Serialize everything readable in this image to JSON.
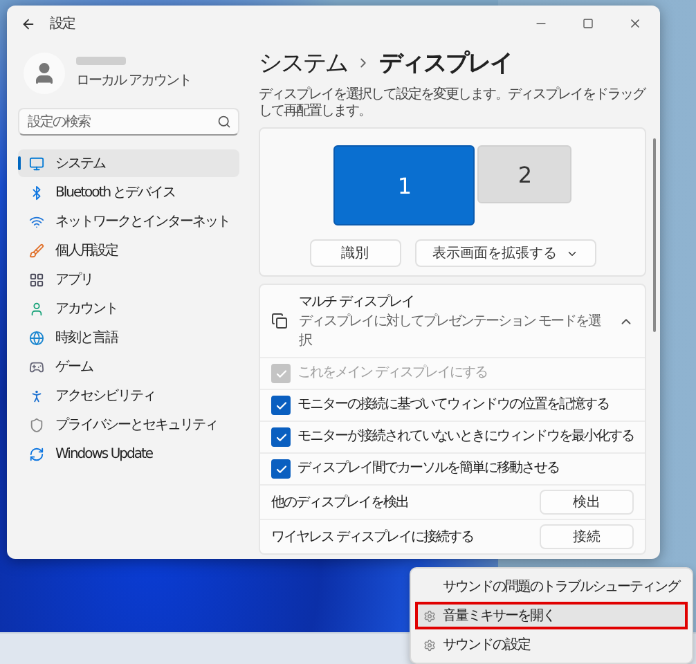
{
  "window": {
    "title": "設定"
  },
  "account": {
    "type": "ローカル アカウント"
  },
  "search": {
    "placeholder": "設定の検索"
  },
  "sidebar": {
    "items": [
      {
        "label": "システム",
        "selected": true
      },
      {
        "label": "Bluetooth とデバイス",
        "selected": false
      },
      {
        "label": "ネットワークとインターネット",
        "selected": false
      },
      {
        "label": "個人用設定",
        "selected": false
      },
      {
        "label": "アプリ",
        "selected": false
      },
      {
        "label": "アカウント",
        "selected": false
      },
      {
        "label": "時刻と言語",
        "selected": false
      },
      {
        "label": "ゲーム",
        "selected": false
      },
      {
        "label": "アクセシビリティ",
        "selected": false
      },
      {
        "label": "プライバシーとセキュリティ",
        "selected": false
      },
      {
        "label": "Windows Update",
        "selected": false
      }
    ]
  },
  "breadcrumb": [
    "システム",
    "ディスプレイ"
  ],
  "description": "ディスプレイを選択して設定を変更します。ディスプレイをドラッグして再配置します。",
  "monitors": [
    {
      "label": "1",
      "selected": true
    },
    {
      "label": "2",
      "selected": false
    }
  ],
  "identify_button": "識別",
  "mode_dropdown": {
    "value": "表示画面を拡張する"
  },
  "multi_display": {
    "title": "マルチ ディスプレイ",
    "subtitle": "ディスプレイに対してプレゼンテーション モードを選択",
    "expanded": true,
    "options": [
      {
        "label": "これをメイン ディスプレイにする",
        "checked": true,
        "disabled": true
      },
      {
        "label": "モニターの接続に基づいてウィンドウの位置を記憶する",
        "checked": true,
        "disabled": false
      },
      {
        "label": "モニターが接続されていないときにウィンドウを最小化する",
        "checked": true,
        "disabled": false
      },
      {
        "label": "ディスプレイ間でカーソルを簡単に移動させる",
        "checked": true,
        "disabled": false
      }
    ],
    "actions": [
      {
        "label": "他のディスプレイを検出",
        "button": "検出"
      },
      {
        "label": "ワイヤレス ディスプレイに接続する",
        "button": "接続"
      }
    ]
  },
  "context_menu": {
    "items": [
      {
        "label": "サウンドの問題のトラブルシューティング",
        "highlighted": false
      },
      {
        "label": "音量ミキサーを開く",
        "highlighted": true
      },
      {
        "label": "サウンドの設定",
        "highlighted": false
      }
    ]
  }
}
